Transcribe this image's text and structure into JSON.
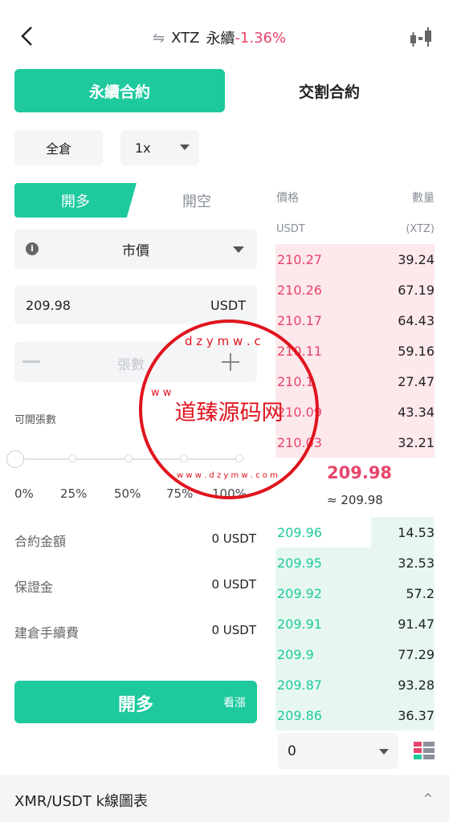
{
  "header": {
    "pair": "XTZ",
    "contract_type": "永續",
    "change": "-1.36%"
  },
  "tabs": {
    "perpetual": "永續合約",
    "delivery": "交割合約"
  },
  "margin_mode": "全倉",
  "leverage": "1x",
  "direction": {
    "long": "開多",
    "short": "開空"
  },
  "order_type": "市價",
  "price_field": {
    "value": "209.98",
    "unit": "USDT"
  },
  "quantity_field": {
    "placeholder": "張數"
  },
  "available_label": "可開張數",
  "slider": {
    "value_percent": 0,
    "labels": [
      "0%",
      "25%",
      "50%",
      "75%",
      "100%"
    ]
  },
  "summary": [
    {
      "label": "合約金額",
      "value": "0 USDT"
    },
    {
      "label": "保證金",
      "value": "0 USDT"
    },
    {
      "label": "建倉手續費",
      "value": "0 USDT"
    }
  ],
  "submit": {
    "label": "開多",
    "sub": "看漲"
  },
  "orderbook": {
    "price_header": "價格",
    "qty_header": "數量",
    "price_unit": "USDT",
    "qty_unit": "(XTZ)",
    "asks": [
      {
        "price": "210.27",
        "qty": "39.24"
      },
      {
        "price": "210.26",
        "qty": "67.19"
      },
      {
        "price": "210.17",
        "qty": "64.43"
      },
      {
        "price": "210.11",
        "qty": "59.16"
      },
      {
        "price": "210.1",
        "qty": "27.47"
      },
      {
        "price": "210.09",
        "qty": "43.34"
      },
      {
        "price": "210.03",
        "qty": "32.21"
      }
    ],
    "last_price": "209.98",
    "index_price": "≈ 209.98",
    "bids": [
      {
        "price": "209.96",
        "qty": "14.53"
      },
      {
        "price": "209.95",
        "qty": "32.53"
      },
      {
        "price": "209.92",
        "qty": "57.2"
      },
      {
        "price": "209.91",
        "qty": "91.47"
      },
      {
        "price": "209.9",
        "qty": "77.29"
      },
      {
        "price": "209.87",
        "qty": "93.28"
      },
      {
        "price": "209.86",
        "qty": "36.37"
      }
    ],
    "ask_depth_fractions": [
      1,
      1,
      1,
      1,
      1,
      1,
      1
    ],
    "bid_depth_fractions": [
      0.4,
      1,
      1,
      1,
      1,
      1,
      1
    ],
    "precision": "0"
  },
  "bottom_bar": {
    "title": "XMR/USDT  k線圖表"
  },
  "watermark": {
    "top_text": "dzymw.com",
    "center_text": "道臻源码网",
    "bottom_text": "www.dzymw.com"
  },
  "colors": {
    "accent_green": "#1ec99e",
    "down_red": "#e8456b",
    "stamp_red": "#e0141e"
  }
}
